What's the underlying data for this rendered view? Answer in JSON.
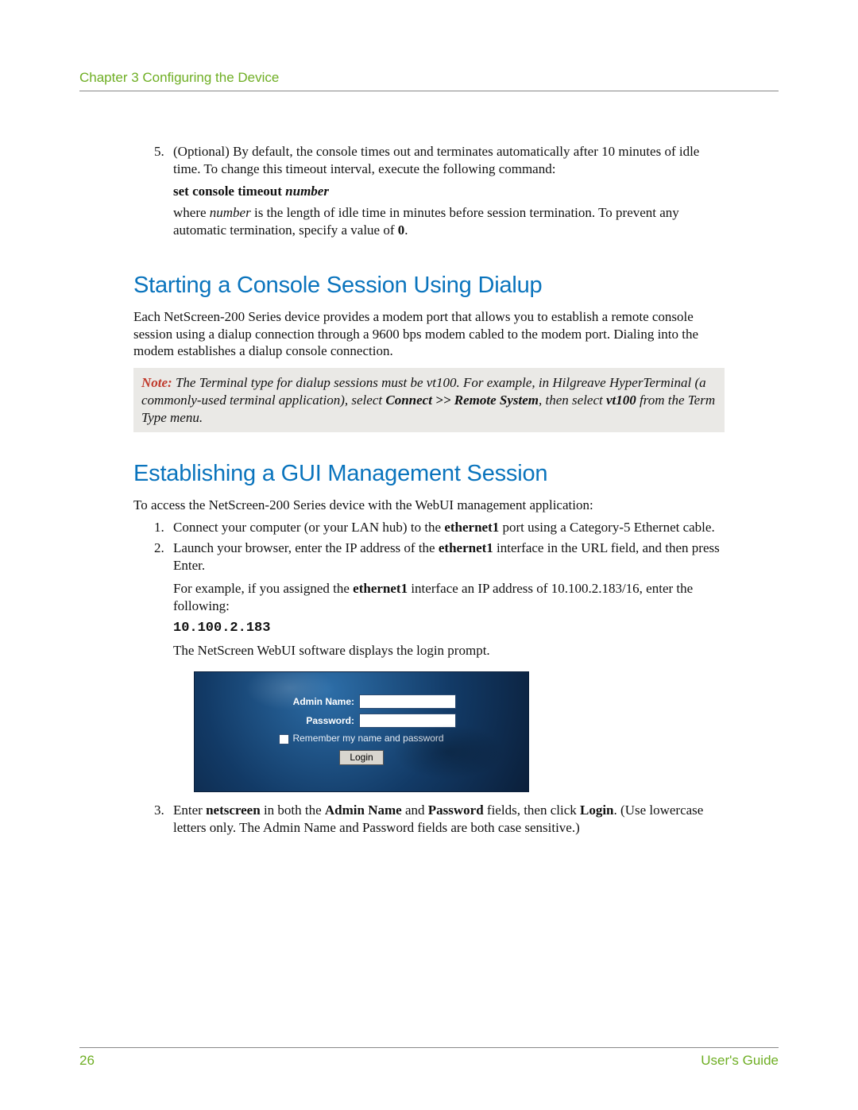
{
  "header": {
    "text": "Chapter 3 Configuring the Device"
  },
  "step5": {
    "num": "5.",
    "p1": "(Optional) By default, the console times out and terminates automatically after 10 minutes of idle time. To change this timeout interval, execute the following command:",
    "cmd_b": "set console timeout ",
    "cmd_i": "number",
    "p2a": "where ",
    "p2i": "number",
    "p2b": " is the length of idle time in minutes before session termination. To prevent any automatic termination, specify a value of ",
    "p2bold": "0",
    "p2end": "."
  },
  "h1a": "Starting a Console Session Using Dialup",
  "dialup_p": "Each NetScreen-200 Series device provides a modem port that allows you to establish a remote console session using a dialup connection through a 9600 bps modem cabled to the modem port. Dialing into the modem establishes a dialup console connection.",
  "note": {
    "lead": "Note:",
    "t1": " The Terminal type for dialup sessions must be vt100. For example, in Hilgreave HyperTerminal (a commonly-used terminal application), select ",
    "b1": "Connect >> Remote System",
    "t2": ", then select ",
    "b2": "vt100",
    "t3": " from the Term Type menu."
  },
  "h1b": "Establishing a GUI Management Session",
  "gui_p": "To access the NetScreen-200 Series device with the WebUI management application:",
  "g1": {
    "num": "1.",
    "a": "Connect your computer (or your LAN hub) to the ",
    "b": "ethernet1",
    "c": " port using a Category-5 Ethernet cable."
  },
  "g2": {
    "num": "2.",
    "a": "Launch your browser, enter the IP address of the ",
    "b": "ethernet1",
    "c": " interface in the URL field, and then press Enter.",
    "p2a": "For example, if you assigned the ",
    "p2b": "ethernet1",
    "p2c": " interface an IP address of 10.100.2.183/16, enter the following:",
    "code": "10.100.2.183",
    "p3": "The NetScreen WebUI software displays the login prompt."
  },
  "login": {
    "admin": "Admin Name:",
    "pass": "Password:",
    "remember": "Remember my name and password",
    "btn": "Login"
  },
  "g3": {
    "num": "3.",
    "a": "Enter ",
    "b1": "netscreen",
    "c": " in both the ",
    "b2": "Admin Name",
    "d": " and ",
    "b3": "Password",
    "e": " fields, then click ",
    "b4": "Login",
    "f": ". (Use lowercase letters only. The Admin Name and Password fields are both case sensitive.)"
  },
  "footer": {
    "page": "26",
    "guide": "User's Guide"
  }
}
